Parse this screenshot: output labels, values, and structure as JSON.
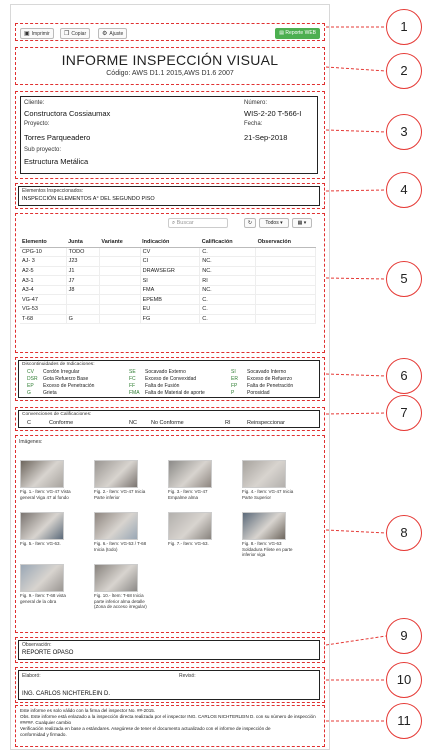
{
  "toolbar": {
    "print": "Imprimir",
    "copy": "Copiar",
    "adjust": "Ajuste",
    "report": "Reporte WEB"
  },
  "header": {
    "title": "INFORME INSPECCIÓN VISUAL",
    "code": "Código: AWS D1.1 2015,AWS D1.6 2007"
  },
  "client": {
    "client_label": "Cliente:",
    "client_value": "Constructora Cossiaumax",
    "number_label": "Número:",
    "number_value": "WIS-2-20 T-566-I",
    "project_label": "Proyecto:",
    "project_value": "Torres Parqueadero",
    "date_label": "Fecha:",
    "date_value": "21-Sep-2018",
    "subproject_label": "Sub proyecto:",
    "subproject_value": "Estructura Metálica"
  },
  "elements": {
    "label": "Elementos Inspeccionados:",
    "value": "INSPECCIÓN ELEMENTOS A° DEL SEGUNDO PISO"
  },
  "grid": {
    "search_placeholder": "Buscar",
    "cols_label": "Todos",
    "columns": [
      "Elemento",
      "Junta",
      "Variante",
      "Indicación",
      "Calificación",
      "Observación"
    ],
    "rows": [
      [
        "CPG-10",
        "TODO",
        "",
        "CV",
        "C.",
        ""
      ],
      [
        "AJ- 3",
        "J23",
        "",
        "CI",
        "NC.",
        ""
      ],
      [
        "A2-5",
        "J1",
        "",
        "DRAWSEGR",
        "NC.",
        ""
      ],
      [
        "A3-1",
        "J7",
        "",
        "SI",
        "RI",
        ""
      ],
      [
        "A3-4",
        "J8",
        "",
        "FMA",
        "NC.",
        ""
      ],
      [
        "VG-47",
        "",
        "",
        "EPEMB",
        "C.",
        ""
      ],
      [
        "VG-53",
        "",
        "",
        "EU",
        "C.",
        ""
      ],
      [
        "T-68",
        "G",
        "",
        "FG",
        "C.",
        ""
      ]
    ]
  },
  "discontinuities": {
    "title": "Discontinuidades de Indicaciones:",
    "items": [
      [
        "CV",
        "Cordón Irregular"
      ],
      [
        "SE",
        "Socavado Externo"
      ],
      [
        "SI",
        "Socavado Interno"
      ],
      [
        "DSR",
        "Gota Refuerzo Base"
      ],
      [
        "FC",
        "Exceso de Convexidad"
      ],
      [
        "ER",
        "Exceso de Refuerzo"
      ],
      [
        "EP",
        "Exceso de Penetración"
      ],
      [
        "FF",
        "Falta de Fusión"
      ],
      [
        "FP",
        "Falta de Penetración"
      ],
      [
        "G",
        "Grieta"
      ],
      [
        "FMA",
        "Falta de Material de aporte"
      ],
      [
        "P",
        "Porosidad"
      ]
    ]
  },
  "conventions": {
    "title": "Convenciones de Calificaciones:",
    "items": [
      [
        "C",
        "Conforme"
      ],
      [
        "NC",
        "No Conforme"
      ],
      [
        "RI",
        "Reinspeccionar"
      ]
    ]
  },
  "images": {
    "title": "Imágenes:",
    "items": [
      "Fig. 1.- Ítem: VG-47 Vista general Viga 47 al fondo",
      "Fig. 2.- Ítem: VG-47 Inicia Parte inferior",
      "Fig. 3.- Ítem: VG-47 Empalme alma",
      "Fig. 4.- Ítem: VG-47 Inicia Parte Superior",
      "Fig. 5.- Ítem: VG-63.",
      "Fig. 6.- Ítem: VG-53 / T-68 Inicia (todo)",
      "Fig. 7.- Ítem: VG-63.",
      "Fig. 8.- Ítem: VG-63 Soldadura Filete en parte inferior viga",
      "Fig. 9.- Ítem: T-68 vista general de la obra",
      "Fig. 10.- Ítem: T-68 Inicia parte inferior alma detalle (Zona de acceso irregular)"
    ]
  },
  "observations": {
    "label": "Observación:",
    "value": "REPORTE OPASO"
  },
  "signatures": {
    "made_label": "Elaboró:",
    "made_value": "ING. CARLOS NICHTERLEIN D.",
    "reviewed_label": "Revisó:"
  },
  "footer": {
    "lines": [
      "Este informe es solo válido con la firma del inspector No. ##-2015.",
      "Obs. Este informe está enlazado a la inspección directa realizada por el inspector ING. CARLOS NICHTERLEIN D. con su número de inspección #####. Cualquier cambio",
      "Verificación realizada en base a estándares. Asegúrese de tener el documento actualizado con el informe de inspección de",
      "conformidad y firmado."
    ]
  },
  "callouts": [
    "1",
    "2",
    "3",
    "4",
    "5",
    "6",
    "7",
    "8",
    "9",
    "10",
    "11"
  ],
  "colors": {
    "accent_green": "#4caf50",
    "section_border": "#e03030",
    "callout_border": "#e53935"
  }
}
